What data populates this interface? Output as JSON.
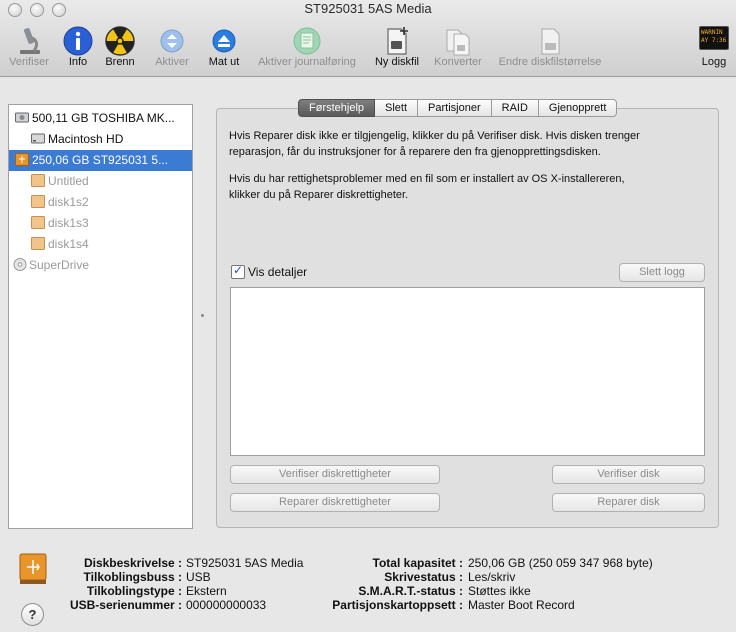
{
  "window": {
    "title": "ST925031 5AS Media"
  },
  "toolbar": {
    "verify": "Verifiser",
    "info": "Info",
    "burn": "Brenn",
    "activate": "Aktiver",
    "eject": "Mat ut",
    "enable_journal": "Aktiver journalføring",
    "new_image": "Ny diskfil",
    "convert": "Konverter",
    "resize_image": "Endre diskfilstørrelse",
    "log": "Logg",
    "log_icon_text": [
      "WARNIN",
      "AY 7:36"
    ]
  },
  "sidebar": {
    "items": [
      {
        "label": "500,11 GB TOSHIBA MK...",
        "icon": "internal-disk-icon"
      },
      {
        "label": "Macintosh HD",
        "icon": "volume-icon"
      },
      {
        "label": "250,06 GB ST925031 5...",
        "icon": "external-usb-disk-icon",
        "selected": true
      },
      {
        "label": "Untitled",
        "icon": "usb-volume-icon"
      },
      {
        "label": "disk1s2",
        "icon": "usb-volume-icon"
      },
      {
        "label": "disk1s3",
        "icon": "usb-volume-icon"
      },
      {
        "label": "disk1s4",
        "icon": "usb-volume-icon"
      },
      {
        "label": "SuperDrive",
        "icon": "optical-drive-icon"
      }
    ]
  },
  "tabs": [
    "Førstehjelp",
    "Slett",
    "Partisjoner",
    "RAID",
    "Gjenopprett"
  ],
  "first_aid": {
    "help_lines_1": [
      "Hvis Reparer disk ikke er tilgjengelig, klikker du på Verifiser disk. Hvis disken trenger",
      "reparasjon, får du instruksjoner for å reparere den fra gjenopprettingsdisken."
    ],
    "help_lines_2": [
      "Hvis du har rettighetsproblemer med en fil som er installert av OS X-installereren,",
      "klikker du på Reparer diskrettigheter."
    ],
    "show_details": "Vis detaljer",
    "show_details_checked": true,
    "clear_log": "Slett logg",
    "verify_permissions": "Verifiser diskrettigheter",
    "verify_disk": "Verifiser disk",
    "repair_permissions": "Reparer diskrettigheter",
    "repair_disk": "Reparer disk"
  },
  "info": {
    "left": [
      {
        "key": "Diskbeskrivelse :",
        "value": "ST925031 5AS Media"
      },
      {
        "key": "Tilkoblingsbuss :",
        "value": "USB"
      },
      {
        "key": "Tilkoblingstype :",
        "value": "Ekstern"
      },
      {
        "key": "USB-serienummer :",
        "value": "000000000033"
      }
    ],
    "right": [
      {
        "key": "Total kapasitet :",
        "value": "250,06 GB (250 059 347 968 byte)"
      },
      {
        "key": "Skrivestatus :",
        "value": "Les/skriv"
      },
      {
        "key": "S.M.A.R.T.-status :",
        "value": "Støttes ikke"
      },
      {
        "key": "Partisjonskartoppsett :",
        "value": "Master Boot Record"
      }
    ]
  },
  "help_button": "?",
  "colors": {
    "selection": "#3b7bd4",
    "usb_disk": "#e8962a",
    "info_icon": "#2a5fd6"
  }
}
